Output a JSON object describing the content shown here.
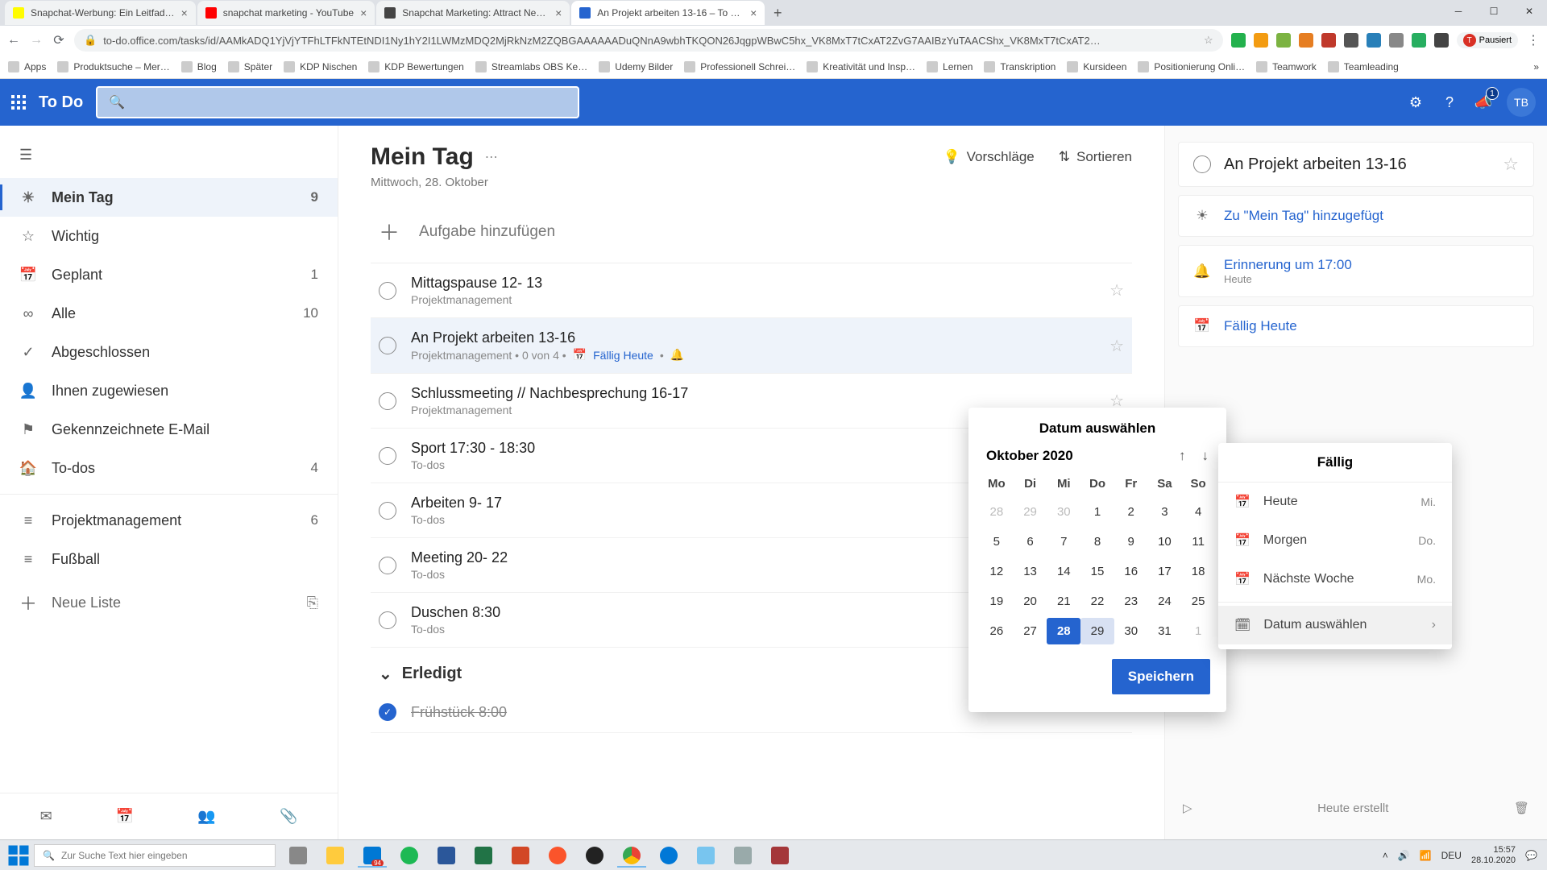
{
  "browser": {
    "tabs": [
      {
        "title": "Snapchat-Werbung: Ein Leitfad…"
      },
      {
        "title": "snapchat marketing - YouTube"
      },
      {
        "title": "Snapchat Marketing: Attract New…"
      },
      {
        "title": "An Projekt arbeiten 13-16 – To D…"
      }
    ],
    "url": "to-do.office.com/tasks/id/AAMkADQ1YjVjYTFhLTFkNTEtNDI1Ny1hY2I1LWMzMDQ2MjRkNzM2ZQBGAAAAAADuQNnA9wbhTKQON26JqgpWBwC5hx_VK8MxT7tCxAT2ZvG7AAIBzYuTAACShx_VK8MxT7tCxAT2…",
    "paused": "Pausiert",
    "bookmarks": [
      "Apps",
      "Produktsuche – Mer…",
      "Blog",
      "Später",
      "KDP Nischen",
      "KDP Bewertungen",
      "Streamlabs OBS Ke…",
      "Udemy Bilder",
      "Professionell Schrei…",
      "Kreativität und Insp…",
      "Lernen",
      "Transkription",
      "Kursideen",
      "Positionierung Onli…",
      "Teamwork",
      "Teamleading"
    ]
  },
  "header": {
    "app": "To Do",
    "notif": "1",
    "initials": "TB"
  },
  "sidebar": {
    "items": [
      {
        "icon": "sun",
        "label": "Mein Tag",
        "count": "9",
        "active": true
      },
      {
        "icon": "star",
        "label": "Wichtig"
      },
      {
        "icon": "calendar",
        "label": "Geplant",
        "count": "1"
      },
      {
        "icon": "infinity",
        "label": "Alle",
        "count": "10"
      },
      {
        "icon": "check",
        "label": "Abgeschlossen"
      },
      {
        "icon": "user",
        "label": "Ihnen zugewiesen"
      },
      {
        "icon": "flag",
        "label": "Gekennzeichnete E-Mail"
      },
      {
        "icon": "home",
        "label": "To-dos",
        "count": "4"
      }
    ],
    "lists": [
      {
        "label": "Projektmanagement",
        "count": "6"
      },
      {
        "label": "Fußball"
      }
    ],
    "newList": "Neue Liste"
  },
  "content": {
    "title": "Mein Tag",
    "subtitle": "Mittwoch, 28. Oktober",
    "suggest": "Vorschläge",
    "sort": "Sortieren",
    "addPlaceholder": "Aufgabe hinzufügen",
    "tasks": [
      {
        "title": "Mittagspause 12- 13",
        "meta": "Projektmanagement"
      },
      {
        "title": "An Projekt arbeiten 13-16",
        "meta": "Projektmanagement  •  0 von 4  •",
        "due": "Fällig Heute",
        "bell": true,
        "selected": true
      },
      {
        "title": "Schlussmeeting // Nachbesprechung 16-17",
        "meta": "Projektmanagement"
      },
      {
        "title": "Sport 17:30 - 18:30",
        "meta": "To-dos"
      },
      {
        "title": "Arbeiten 9- 17",
        "meta": "To-dos"
      },
      {
        "title": "Meeting 20- 22",
        "meta": "To-dos"
      },
      {
        "title": "Duschen 8:30",
        "meta": "To-dos"
      }
    ],
    "doneHeader": "Erledigt",
    "doneTasks": [
      {
        "title": "Frühstück 8:00"
      }
    ]
  },
  "details": {
    "title": "An Projekt arbeiten 13-16",
    "myday": "Zu \"Mein Tag\" hinzugefügt",
    "reminder": "Erinnerung um 17:00",
    "reminderSub": "Heute",
    "due": "Fällig Heute",
    "created": "Heute erstellt"
  },
  "dueFlyout": {
    "header": "Fällig",
    "today": "Heute",
    "todayD": "Mi.",
    "tomorrow": "Morgen",
    "tomorrowD": "Do.",
    "nextweek": "Nächste Woche",
    "nextweekD": "Mo.",
    "pick": "Datum auswählen"
  },
  "cal": {
    "header": "Datum auswählen",
    "month": "Oktober 2020",
    "dh": [
      "Mo",
      "Di",
      "Mi",
      "Do",
      "Fr",
      "Sa",
      "So"
    ],
    "rows": [
      [
        {
          "d": "28",
          "off": true
        },
        {
          "d": "29",
          "off": true
        },
        {
          "d": "30",
          "off": true
        },
        {
          "d": "1"
        },
        {
          "d": "2"
        },
        {
          "d": "3"
        },
        {
          "d": "4"
        }
      ],
      [
        {
          "d": "5"
        },
        {
          "d": "6"
        },
        {
          "d": "7"
        },
        {
          "d": "8"
        },
        {
          "d": "9"
        },
        {
          "d": "10"
        },
        {
          "d": "11"
        }
      ],
      [
        {
          "d": "12"
        },
        {
          "d": "13"
        },
        {
          "d": "14"
        },
        {
          "d": "15"
        },
        {
          "d": "16"
        },
        {
          "d": "17"
        },
        {
          "d": "18"
        }
      ],
      [
        {
          "d": "19"
        },
        {
          "d": "20"
        },
        {
          "d": "21"
        },
        {
          "d": "22"
        },
        {
          "d": "23"
        },
        {
          "d": "24"
        },
        {
          "d": "25"
        }
      ],
      [
        {
          "d": "26"
        },
        {
          "d": "27"
        },
        {
          "d": "28",
          "today": true
        },
        {
          "d": "29",
          "sel": true
        },
        {
          "d": "30"
        },
        {
          "d": "31"
        },
        {
          "d": "1",
          "off": true
        }
      ]
    ],
    "save": "Speichern"
  },
  "taskbar": {
    "search": "Zur Suche Text hier eingeben",
    "lang": "DEU",
    "time": "15:57",
    "date": "28.10.2020",
    "mailCount": "94"
  }
}
